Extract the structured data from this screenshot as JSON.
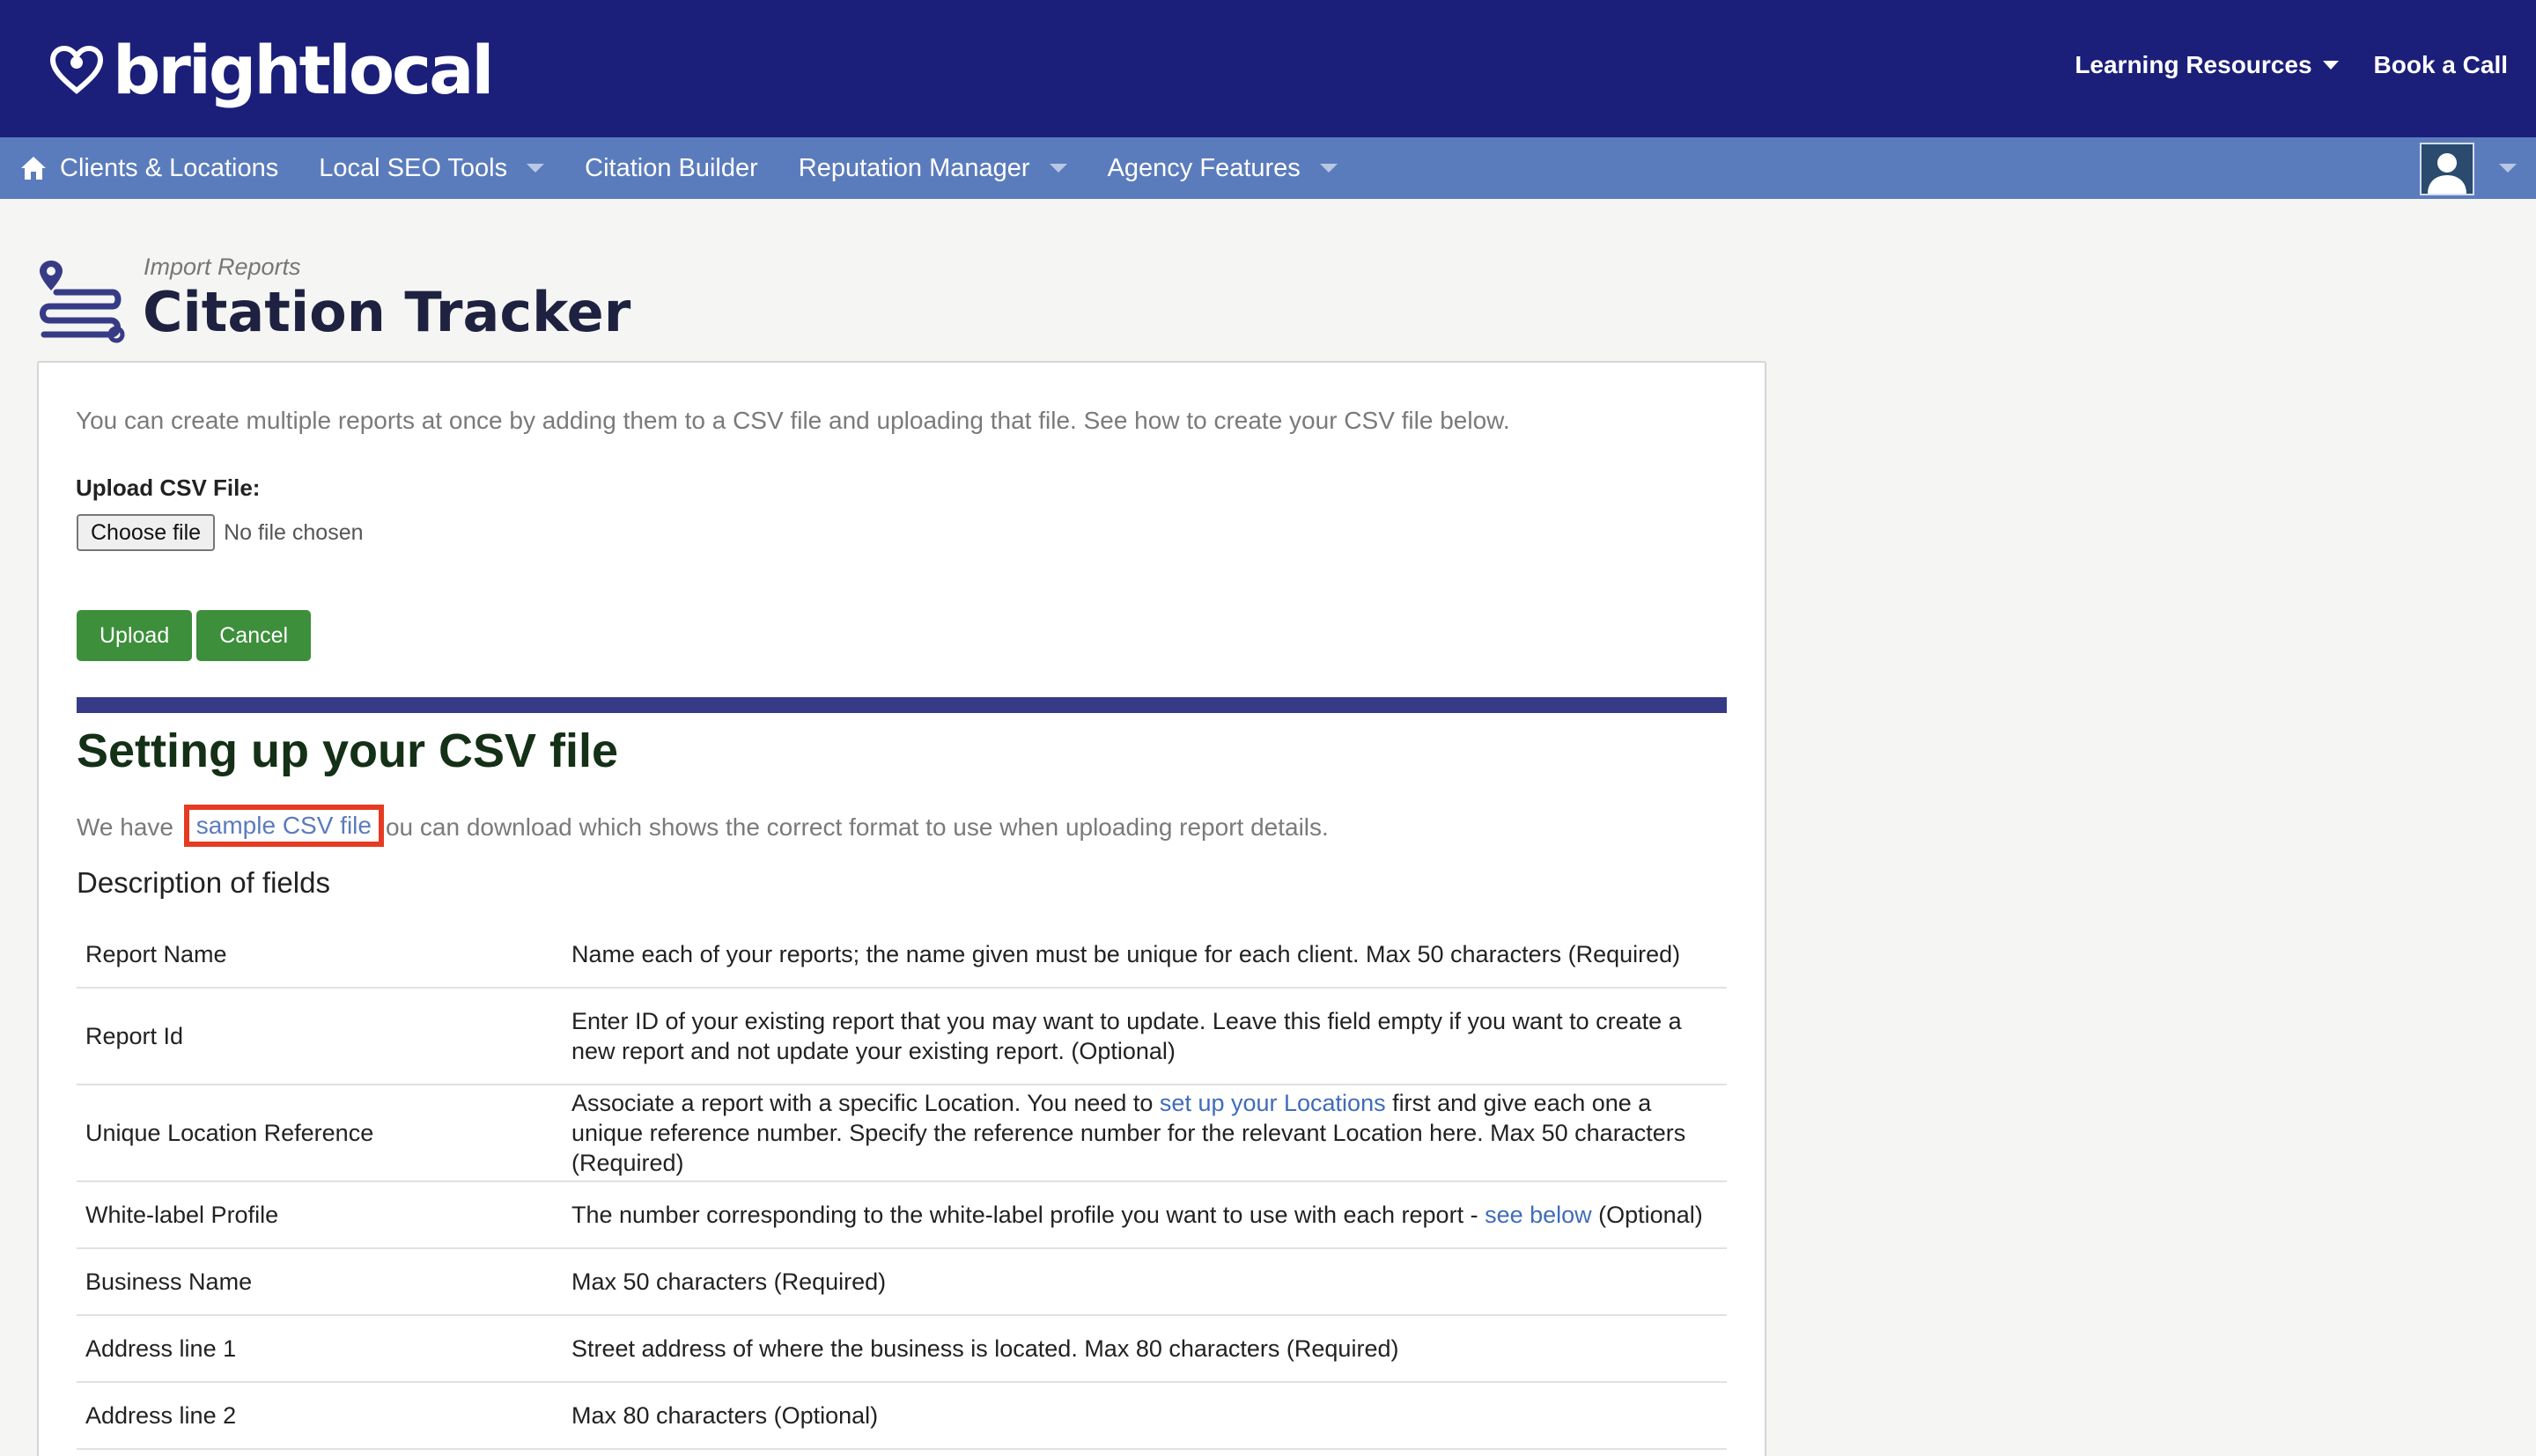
{
  "header": {
    "logo_text": "brightlocal",
    "links": [
      "Learning Resources",
      "Book a Call"
    ]
  },
  "nav": {
    "items": [
      {
        "label": "Clients & Locations",
        "icon": "home-icon",
        "has_dropdown": false
      },
      {
        "label": "Local SEO Tools",
        "has_dropdown": true
      },
      {
        "label": "Citation Builder",
        "has_dropdown": false
      },
      {
        "label": "Reputation Manager",
        "has_dropdown": true
      },
      {
        "label": "Agency Features",
        "has_dropdown": true
      }
    ]
  },
  "page": {
    "breadcrumb": "Import Reports",
    "title": "Citation Tracker"
  },
  "form": {
    "intro": "You can create multiple reports at once by adding them to a CSV file and uploading that file. See how to create your CSV file below.",
    "upload_label": "Upload CSV File:",
    "choose_file_label": "Choose file",
    "no_file_text": "No file chosen",
    "upload_button": "Upload",
    "cancel_button": "Cancel"
  },
  "csv_section": {
    "title": "Setting up your CSV file",
    "sample_prefix": "We have",
    "sample_link": "sample CSV file",
    "sample_suffix": "ou can download which shows the correct format to use when uploading report details.",
    "description_title": "Description of fields"
  },
  "fields": [
    {
      "name": "Report Name",
      "desc": "Name each of your reports; the name given must be unique for each client. Max 50 characters (Required)"
    },
    {
      "name": "Report Id",
      "desc": "Enter ID of your existing report that you may want to update. Leave this field empty if you want to create a new report and not update your existing report. (Optional)"
    },
    {
      "name": "Unique Location Reference",
      "desc_pre": "Associate a report with a specific Location. You need to ",
      "desc_link": "set up your Locations",
      "desc_post": " first and give each one a unique reference number. Specify the reference number for the relevant Location here. Max 50 characters (Required)"
    },
    {
      "name": "White-label Profile",
      "desc_pre": "The number corresponding to the white-label profile you want to use with each report - ",
      "desc_link": "see below",
      "desc_post": " (Optional)"
    },
    {
      "name": "Business Name",
      "desc": "Max 50 characters (Required)"
    },
    {
      "name": "Address line 1",
      "desc": "Street address of where the business is located. Max 80 characters (Required)"
    },
    {
      "name": "Address line 2",
      "desc": "Max 80 characters (Optional)"
    }
  ],
  "colors": {
    "header_bg": "#1b1f7a",
    "nav_bg": "#5b7cbc",
    "button_green": "#3d8f3b",
    "divider": "#373b86",
    "highlight_box": "#e63b23",
    "link": "#3f6cb9"
  }
}
